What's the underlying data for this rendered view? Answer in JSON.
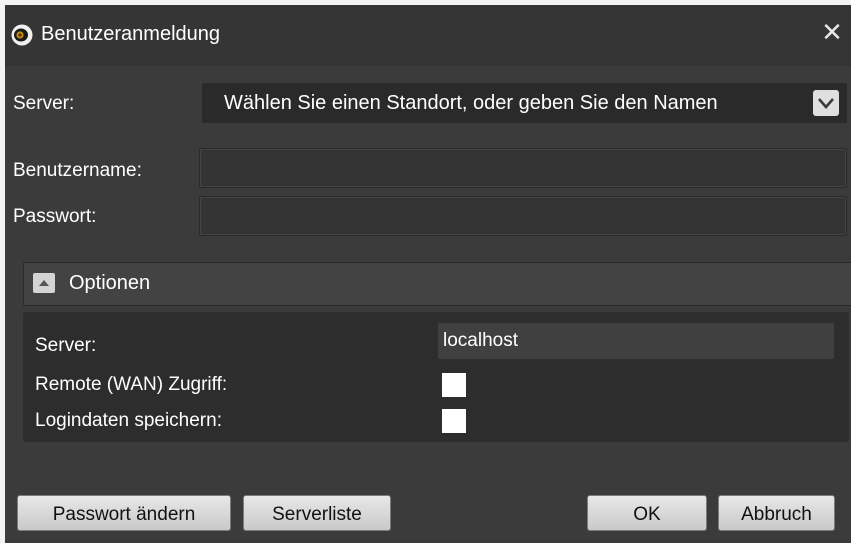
{
  "window": {
    "title": "Benutzeranmeldung",
    "close_glyph": "✕",
    "icon": "eye-logo-icon"
  },
  "login": {
    "server_label": "Server:",
    "server_value": "Wählen Sie einen Standort, oder geben Sie den Namen",
    "username_label": "Benutzername:",
    "username_value": "",
    "password_label": "Passwort:",
    "password_value": ""
  },
  "options": {
    "title": "Optionen",
    "expanded": true,
    "server_label": "Server:",
    "server_value": "localhost",
    "remote_label": "Remote (WAN) Zugriff:",
    "remote_checked": false,
    "save_label": "Logindaten speichern:",
    "save_checked": false
  },
  "buttons": {
    "change_password": "Passwort ändern",
    "server_list": "Serverliste",
    "ok": "OK",
    "cancel": "Abbruch"
  },
  "colors": {
    "dialog_bg": "#3b3b3b",
    "titlebar_bg": "#353535",
    "input_bg": "#2a2a2a",
    "button_bg": "#d9d9d9"
  }
}
